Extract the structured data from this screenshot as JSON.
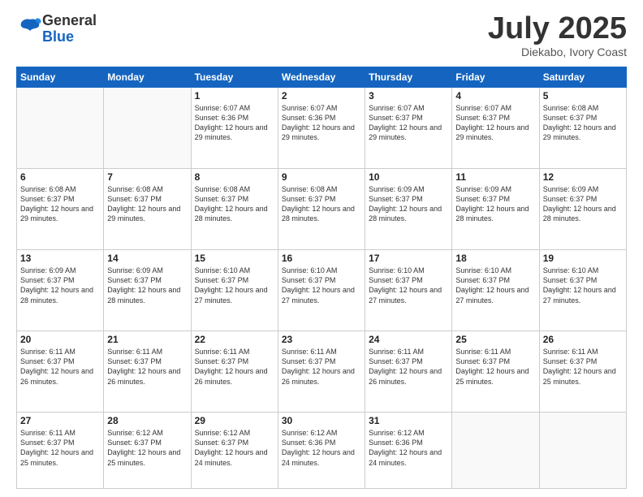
{
  "logo": {
    "general": "General",
    "blue": "Blue"
  },
  "header": {
    "month": "July 2025",
    "location": "Diekabo, Ivory Coast"
  },
  "weekdays": [
    "Sunday",
    "Monday",
    "Tuesday",
    "Wednesday",
    "Thursday",
    "Friday",
    "Saturday"
  ],
  "weeks": [
    [
      {
        "day": "",
        "info": ""
      },
      {
        "day": "",
        "info": ""
      },
      {
        "day": "1",
        "info": "Sunrise: 6:07 AM\nSunset: 6:36 PM\nDaylight: 12 hours and 29 minutes."
      },
      {
        "day": "2",
        "info": "Sunrise: 6:07 AM\nSunset: 6:36 PM\nDaylight: 12 hours and 29 minutes."
      },
      {
        "day": "3",
        "info": "Sunrise: 6:07 AM\nSunset: 6:37 PM\nDaylight: 12 hours and 29 minutes."
      },
      {
        "day": "4",
        "info": "Sunrise: 6:07 AM\nSunset: 6:37 PM\nDaylight: 12 hours and 29 minutes."
      },
      {
        "day": "5",
        "info": "Sunrise: 6:08 AM\nSunset: 6:37 PM\nDaylight: 12 hours and 29 minutes."
      }
    ],
    [
      {
        "day": "6",
        "info": "Sunrise: 6:08 AM\nSunset: 6:37 PM\nDaylight: 12 hours and 29 minutes."
      },
      {
        "day": "7",
        "info": "Sunrise: 6:08 AM\nSunset: 6:37 PM\nDaylight: 12 hours and 29 minutes."
      },
      {
        "day": "8",
        "info": "Sunrise: 6:08 AM\nSunset: 6:37 PM\nDaylight: 12 hours and 28 minutes."
      },
      {
        "day": "9",
        "info": "Sunrise: 6:08 AM\nSunset: 6:37 PM\nDaylight: 12 hours and 28 minutes."
      },
      {
        "day": "10",
        "info": "Sunrise: 6:09 AM\nSunset: 6:37 PM\nDaylight: 12 hours and 28 minutes."
      },
      {
        "day": "11",
        "info": "Sunrise: 6:09 AM\nSunset: 6:37 PM\nDaylight: 12 hours and 28 minutes."
      },
      {
        "day": "12",
        "info": "Sunrise: 6:09 AM\nSunset: 6:37 PM\nDaylight: 12 hours and 28 minutes."
      }
    ],
    [
      {
        "day": "13",
        "info": "Sunrise: 6:09 AM\nSunset: 6:37 PM\nDaylight: 12 hours and 28 minutes."
      },
      {
        "day": "14",
        "info": "Sunrise: 6:09 AM\nSunset: 6:37 PM\nDaylight: 12 hours and 28 minutes."
      },
      {
        "day": "15",
        "info": "Sunrise: 6:10 AM\nSunset: 6:37 PM\nDaylight: 12 hours and 27 minutes."
      },
      {
        "day": "16",
        "info": "Sunrise: 6:10 AM\nSunset: 6:37 PM\nDaylight: 12 hours and 27 minutes."
      },
      {
        "day": "17",
        "info": "Sunrise: 6:10 AM\nSunset: 6:37 PM\nDaylight: 12 hours and 27 minutes."
      },
      {
        "day": "18",
        "info": "Sunrise: 6:10 AM\nSunset: 6:37 PM\nDaylight: 12 hours and 27 minutes."
      },
      {
        "day": "19",
        "info": "Sunrise: 6:10 AM\nSunset: 6:37 PM\nDaylight: 12 hours and 27 minutes."
      }
    ],
    [
      {
        "day": "20",
        "info": "Sunrise: 6:11 AM\nSunset: 6:37 PM\nDaylight: 12 hours and 26 minutes."
      },
      {
        "day": "21",
        "info": "Sunrise: 6:11 AM\nSunset: 6:37 PM\nDaylight: 12 hours and 26 minutes."
      },
      {
        "day": "22",
        "info": "Sunrise: 6:11 AM\nSunset: 6:37 PM\nDaylight: 12 hours and 26 minutes."
      },
      {
        "day": "23",
        "info": "Sunrise: 6:11 AM\nSunset: 6:37 PM\nDaylight: 12 hours and 26 minutes."
      },
      {
        "day": "24",
        "info": "Sunrise: 6:11 AM\nSunset: 6:37 PM\nDaylight: 12 hours and 26 minutes."
      },
      {
        "day": "25",
        "info": "Sunrise: 6:11 AM\nSunset: 6:37 PM\nDaylight: 12 hours and 25 minutes."
      },
      {
        "day": "26",
        "info": "Sunrise: 6:11 AM\nSunset: 6:37 PM\nDaylight: 12 hours and 25 minutes."
      }
    ],
    [
      {
        "day": "27",
        "info": "Sunrise: 6:11 AM\nSunset: 6:37 PM\nDaylight: 12 hours and 25 minutes."
      },
      {
        "day": "28",
        "info": "Sunrise: 6:12 AM\nSunset: 6:37 PM\nDaylight: 12 hours and 25 minutes."
      },
      {
        "day": "29",
        "info": "Sunrise: 6:12 AM\nSunset: 6:37 PM\nDaylight: 12 hours and 24 minutes."
      },
      {
        "day": "30",
        "info": "Sunrise: 6:12 AM\nSunset: 6:36 PM\nDaylight: 12 hours and 24 minutes."
      },
      {
        "day": "31",
        "info": "Sunrise: 6:12 AM\nSunset: 6:36 PM\nDaylight: 12 hours and 24 minutes."
      },
      {
        "day": "",
        "info": ""
      },
      {
        "day": "",
        "info": ""
      }
    ]
  ]
}
